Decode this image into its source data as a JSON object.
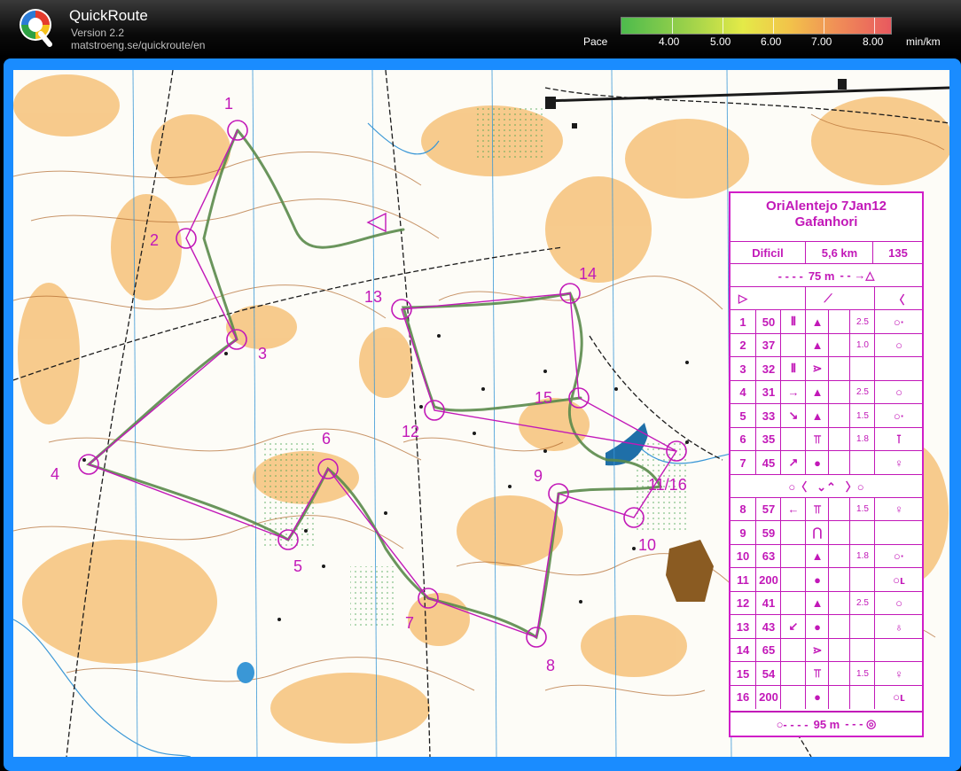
{
  "app": {
    "title": "QuickRoute",
    "version": "Version 2.2",
    "url": "matstroeng.se/quickroute/en"
  },
  "pace": {
    "label": "Pace",
    "ticks": [
      "4.00",
      "5.00",
      "6.00",
      "7.00",
      "8.00"
    ],
    "unit": "min/km",
    "colors": [
      "#4dbb4d",
      "#9ed24a",
      "#e4ea48",
      "#f2c44a",
      "#f08e57",
      "#e8595f"
    ]
  },
  "map": {
    "controls": [
      {
        "label": "1"
      },
      {
        "label": "2"
      },
      {
        "label": "3"
      },
      {
        "label": "4"
      },
      {
        "label": "5"
      },
      {
        "label": "6"
      },
      {
        "label": "7"
      },
      {
        "label": "8"
      },
      {
        "label": "9"
      },
      {
        "label": "10"
      },
      {
        "label": "11/16"
      },
      {
        "label": "12"
      },
      {
        "label": "13"
      },
      {
        "label": "14"
      },
      {
        "label": "15"
      }
    ],
    "course_color": "#c218b8",
    "route_color": "#5a8a4a"
  },
  "description": {
    "event": "OriAlentejo 7Jan12",
    "area": "Gafanhori",
    "class": "Dificil",
    "length": "5,6 km",
    "climb": "135",
    "start_leg": "75 m",
    "finish_leg": "95 m",
    "rows": [
      {
        "n": "1",
        "code": "50",
        "dim": "2.5"
      },
      {
        "n": "2",
        "code": "37",
        "dim": "1.0"
      },
      {
        "n": "3",
        "code": "32",
        "dim": ""
      },
      {
        "n": "4",
        "code": "31",
        "dim": "2.5"
      },
      {
        "n": "5",
        "code": "33",
        "dim": "1.5"
      },
      {
        "n": "6",
        "code": "35",
        "dim": "1.8"
      },
      {
        "n": "7",
        "code": "45",
        "dim": ""
      },
      {
        "n": "8",
        "code": "57",
        "dim": "1.5"
      },
      {
        "n": "9",
        "code": "59",
        "dim": ""
      },
      {
        "n": "10",
        "code": "63",
        "dim": "1.8"
      },
      {
        "n": "11",
        "code": "200",
        "dim": ""
      },
      {
        "n": "12",
        "code": "41",
        "dim": "2.5"
      },
      {
        "n": "13",
        "code": "43",
        "dim": ""
      },
      {
        "n": "14",
        "code": "65",
        "dim": ""
      },
      {
        "n": "15",
        "code": "54",
        "dim": "1.5"
      },
      {
        "n": "16",
        "code": "200",
        "dim": ""
      }
    ]
  }
}
